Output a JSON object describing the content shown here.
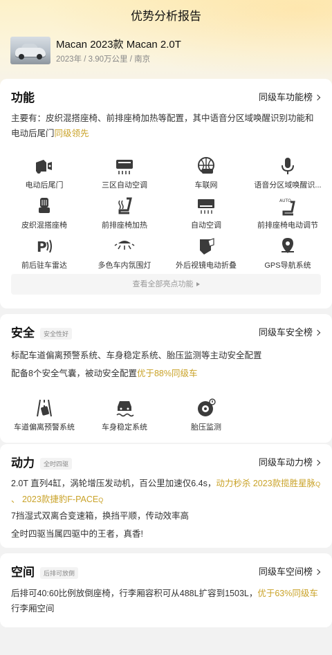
{
  "page": {
    "title": "优势分析报告"
  },
  "car": {
    "name": "Macan 2023款 Macan 2.0T",
    "meta": "2023年 / 3.90万公里 / 南京"
  },
  "function": {
    "title": "功能",
    "rank": "同级车功能榜",
    "summary_prefix": "主要有：皮织混搭座椅、前排座椅加热等配置，其中语音分区域唤醒识别功能和电动后尾门",
    "summary_highlight": "同级领先",
    "features": [
      {
        "label": "电动后尾门",
        "icon": "tailgate-icon"
      },
      {
        "label": "三区自动空调",
        "icon": "climate-icon"
      },
      {
        "label": "车联网",
        "icon": "connected-car-icon"
      },
      {
        "label": "语音分区域唤醒识...",
        "icon": "microphone-icon"
      },
      {
        "label": "皮织混搭座椅",
        "icon": "seat-icon"
      },
      {
        "label": "前排座椅加热",
        "icon": "seat-heating-icon"
      },
      {
        "label": "自动空调",
        "icon": "ac-icon"
      },
      {
        "label": "前排座椅电动调节",
        "icon": "seat-auto-icon"
      },
      {
        "label": "前后驻车雷达",
        "icon": "parking-radar-icon"
      },
      {
        "label": "多色车内氛围灯",
        "icon": "ambient-light-icon"
      },
      {
        "label": "外后视镜电动折叠",
        "icon": "mirror-icon"
      },
      {
        "label": "GPS导航系统",
        "icon": "gps-icon"
      }
    ],
    "view_all": "查看全部亮点功能"
  },
  "safety": {
    "title": "安全",
    "tag": "安全性好",
    "rank": "同级车安全榜",
    "line1": "标配车道偏离预警系统、车身稳定系统、胎压监测等主动安全配置",
    "line2_prefix": "配备8个安全气囊，被动安全配置",
    "line2_highlight": "优于88%同级车",
    "features": [
      {
        "label": "车道偏离预警系统",
        "icon": "lane-departure-icon"
      },
      {
        "label": "车身稳定系统",
        "icon": "stability-icon"
      },
      {
        "label": "胎压监测",
        "icon": "tire-pressure-icon"
      }
    ]
  },
  "power": {
    "title": "动力",
    "tag": "全时四驱",
    "rank": "同级车动力榜",
    "line1_prefix": "2.0T 直列4缸，涡轮增压发动机，百公里加速仅6.4s，",
    "line1_highlight": "动力秒杀 2023款揽胜星脉",
    "line1_sep": " 、 ",
    "line1_highlight2": "2023款捷豹F-PACE",
    "line2": "7挡湿式双离合变速箱，换挡平顺，传动效率高",
    "line3": "全时四驱当属四驱中的王者，真香!"
  },
  "space": {
    "title": "空间",
    "tag": "后排可放倒",
    "rank": "同级车空间榜",
    "line1_prefix": "后排可40:60比例放倒座椅，行李厢容积可从488L扩容到1503L，",
    "line1_highlight": "优于63%同级车",
    "line1_suffix": "行李厢空间"
  },
  "colors": {
    "accent": "#c9a227",
    "hero": "#fdf1c8"
  }
}
